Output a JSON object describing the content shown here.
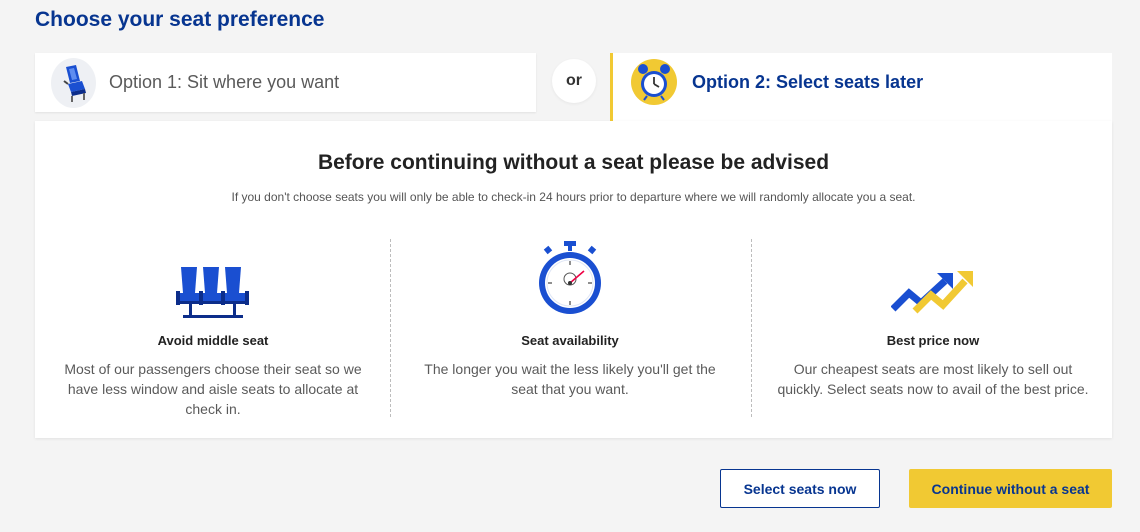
{
  "page": {
    "title": "Choose your seat preference"
  },
  "options": {
    "option1_label": "Option 1: Sit where you want",
    "or_label": "or",
    "option2_label": "Option 2: Select seats later"
  },
  "advisory": {
    "heading": "Before continuing without a seat please be advised",
    "subtext": "If you don't choose seats you will only be able to check-in 24 hours prior to departure where we will randomly allocate you a seat."
  },
  "features": [
    {
      "title": "Avoid middle seat",
      "description": "Most of our passengers choose their seat so we have less window and aisle seats to allocate at check in.",
      "icon": "airplane-seats-icon"
    },
    {
      "title": "Seat availability",
      "description": "The longer you wait the less likely you'll get the seat that you want.",
      "icon": "stopwatch-icon"
    },
    {
      "title": "Best price now",
      "description": "Our cheapest seats are most likely to sell out quickly. Select seats now to avail of the best price.",
      "icon": "trending-up-arrows-icon"
    }
  ],
  "actions": {
    "select_seats_now": "Select seats now",
    "continue_without_seat": "Continue without a seat"
  },
  "colors": {
    "brand_blue": "#073590",
    "accent_yellow": "#f1c933",
    "background": "#f4f4f4"
  }
}
